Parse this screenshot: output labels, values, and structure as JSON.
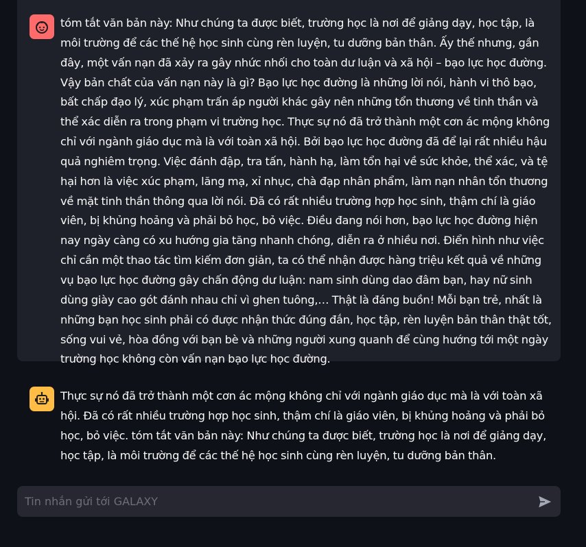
{
  "messages": [
    {
      "role": "user",
      "avatar_icon": "user-face-icon",
      "avatar_color": "#ff6b6b",
      "text": "tóm tắt văn bản này: Như chúng ta được biết, trường học là nơi để giảng dạy, học tập, là môi trường để các thế hệ học sinh cùng rèn luyện, tu dưỡng bản thân. Ấy thế nhưng, gần đây, một vấn nạn đã xảy ra gây nhức nhối cho toàn dư luận và xã hội – bạo lực học đường. Vậy bản chất của vấn nạn này là gì? Bạo lực học đường là những lời nói, hành vi thô bạo, bất chấp đạo lý, xúc phạm trấn áp người khác gây nên những tổn thương về tinh thần và thể xác diễn ra trong phạm vi trường học. Thực sự nó đã trở thành một cơn ác mộng không chỉ với ngành giáo dục mà là với toàn xã hội. Bởi bạo lực học đường đã để lại rất nhiều hậu quả nghiêm trọng. Việc đánh đập, tra tấn, hành hạ, làm tổn hại về sức khỏe, thể xác, và tệ hại hơn là việc xúc phạm, lăng mạ, xỉ nhục, chà đạp nhân phẩm, làm nạn nhân tổn thương về mặt tinh thần thông qua lời nói. Đã có rất nhiều trường hợp học sinh, thậm chí là giáo viên, bị khủng hoảng và phải bỏ học, bỏ việc. Điều đang nói hơn, bạo lực học đường hiện nay ngày càng có xu hướng gia tăng nhanh chóng, diễn ra ở nhiều nơi. Điển hình như việc chỉ cần một thao tác tìm kiếm đơn giản, ta có thể nhận được hàng triệu kết quả về những vụ bạo lực học đường gây chấn động dư luận: nam sinh dùng dao đâm bạn, hay nữ sinh dùng giày cao gót đánh nhau chỉ vì ghen tuông,… Thật là đáng buồn! Mỗi bạn trẻ, nhất là những bạn học sinh phải có được nhận thức đúng đắn, học tập, rèn luyện bản thân thật tốt, sống vui vẻ, hòa đồng với bạn bè và những người xung quanh để cùng hướng tới một ngày trường học không còn vấn nạn bạo lực học đường."
    },
    {
      "role": "assistant",
      "avatar_icon": "robot-icon",
      "avatar_color": "#ffbd45",
      "text": "Thực sự nó đã trở thành một cơn ác mộng không chỉ với ngành giáo dục mà là với toàn xã hội. Đã có rất nhiều trường hợp học sinh, thậm chí là giáo viên, bị khủng hoảng và phải bỏ học, bỏ việc. tóm tắt văn bản này: Như chúng ta được biết, trường học là nơi để giảng dạy, học tập, là môi trường để các thế hệ học sinh cùng rèn luyện, tu dưỡng bản thân."
    }
  ],
  "input": {
    "placeholder": "Tin nhắn gửi tới GALAXY",
    "value": "",
    "send_icon": "send-icon"
  },
  "colors": {
    "background": "#0e1117",
    "user_message_bg": "#1e2129",
    "input_bg": "#262730",
    "text": "#fafafa",
    "placeholder": "#6c6f7a"
  }
}
